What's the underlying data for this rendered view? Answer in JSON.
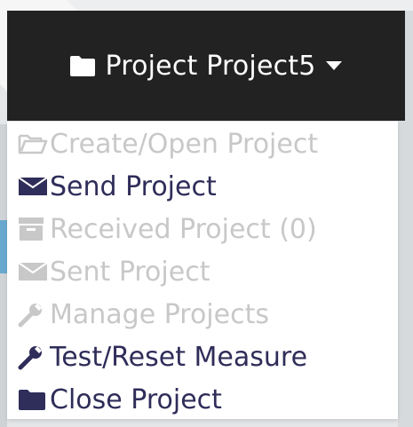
{
  "navbar": {
    "title": "Project Project5",
    "folder_icon": "folder-icon",
    "caret_icon": "caret-down-icon",
    "background": "#222222",
    "text_color": "#ffffff"
  },
  "menu": {
    "items": [
      {
        "label": "Create/Open Project",
        "icon": "folder-open-icon",
        "enabled": false
      },
      {
        "label": "Send Project",
        "icon": "envelope-icon",
        "enabled": true
      },
      {
        "label": "Received Project (0)",
        "icon": "inbox-icon",
        "enabled": false
      },
      {
        "label": "Sent Project",
        "icon": "envelope-icon",
        "enabled": false
      },
      {
        "label": "Manage Projects",
        "icon": "wrench-icon",
        "enabled": false
      },
      {
        "label": "Test/Reset Measure",
        "icon": "wrench-icon",
        "enabled": true
      },
      {
        "label": "Close Project",
        "icon": "folder-icon",
        "enabled": true
      }
    ],
    "enabled_color": "#2f2d59",
    "disabled_color": "#c8c8c8"
  }
}
